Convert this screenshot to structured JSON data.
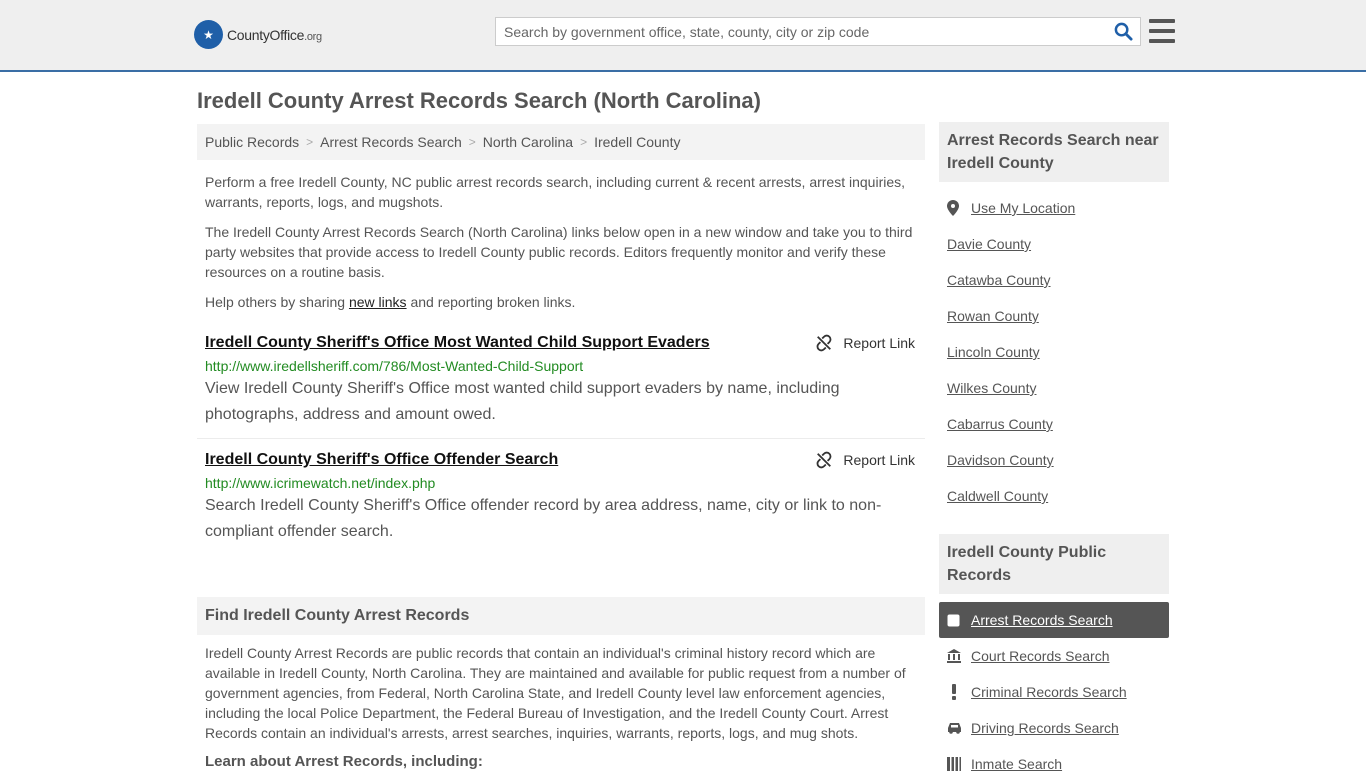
{
  "header": {
    "logo_main": "CountyOffice",
    "logo_org": ".org",
    "search_placeholder": "Search by government office, state, county, city or zip code"
  },
  "page_title": "Iredell County Arrest Records Search (North Carolina)",
  "breadcrumb": [
    "Public Records",
    "Arrest Records Search",
    "North Carolina",
    "Iredell County"
  ],
  "intro": {
    "p1": "Perform a free Iredell County, NC public arrest records search, including current & recent arrests, arrest inquiries, warrants, reports, logs, and mugshots.",
    "p2": "The Iredell County Arrest Records Search (North Carolina) links below open in a new window and take you to third party websites that provide access to Iredell County public records. Editors frequently monitor and verify these resources on a routine basis.",
    "p3_before": "Help others by sharing ",
    "p3_link": "new links",
    "p3_after": " and reporting broken links."
  },
  "report_label": "Report Link",
  "results": [
    {
      "title": "Iredell County Sheriff's Office Most Wanted Child Support Evaders",
      "url": "http://www.iredellsheriff.com/786/Most-Wanted-Child-Support",
      "desc": "View Iredell County Sheriff's Office most wanted child support evaders by name, including photographs, address and amount owed."
    },
    {
      "title": "Iredell County Sheriff's Office Offender Search",
      "url": "http://www.icrimewatch.net/index.php",
      "desc": "Search Iredell County Sheriff's Office offender record by area address, name, city or link to non-compliant offender search."
    }
  ],
  "find_section": {
    "heading": "Find Iredell County Arrest Records",
    "text": "Iredell County Arrest Records are public records that contain an individual's criminal history record which are available in Iredell County, North Carolina. They are maintained and available for public request from a number of government agencies, from Federal, North Carolina State, and Iredell County level law enforcement agencies, including the local Police Department, the Federal Bureau of Investigation, and the Iredell County Court. Arrest Records contain an individual's arrests, arrest searches, inquiries, warrants, reports, logs, and mug shots.",
    "learn": "Learn about Arrest Records, including:"
  },
  "sidebar": {
    "near_heading": "Arrest Records Search near Iredell County",
    "use_location": "Use My Location",
    "near_items": [
      "Davie County",
      "Catawba County",
      "Rowan County",
      "Lincoln County",
      "Wilkes County",
      "Cabarrus County",
      "Davidson County",
      "Caldwell County"
    ],
    "public_heading": "Iredell County Public Records",
    "public_active": "Arrest Records Search",
    "public_items": [
      {
        "label": "Court Records Search",
        "icon": "courthouse-icon"
      },
      {
        "label": "Criminal Records Search",
        "icon": "exclamation-icon"
      },
      {
        "label": "Driving Records Search",
        "icon": "car-icon"
      },
      {
        "label": "Inmate Search",
        "icon": "inmate-icon"
      }
    ]
  }
}
